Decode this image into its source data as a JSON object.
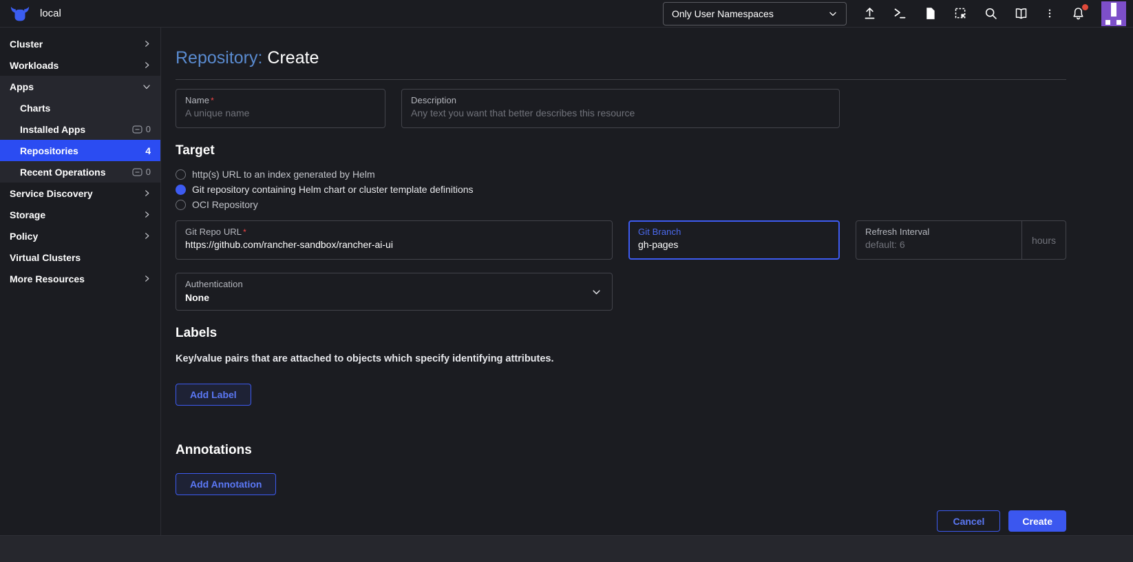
{
  "topbar": {
    "cluster_name": "local",
    "namespace_filter": "Only User Namespaces"
  },
  "sidebar": {
    "items": [
      {
        "label": "Cluster"
      },
      {
        "label": "Workloads"
      },
      {
        "label": "Apps"
      },
      {
        "label": "Charts"
      },
      {
        "label": "Installed Apps",
        "count": "0"
      },
      {
        "label": "Repositories",
        "count": "4"
      },
      {
        "label": "Recent Operations",
        "count": "0"
      },
      {
        "label": "Service Discovery"
      },
      {
        "label": "Storage"
      },
      {
        "label": "Policy"
      },
      {
        "label": "Virtual Clusters"
      },
      {
        "label": "More Resources"
      }
    ]
  },
  "page": {
    "title_type": "Repository:",
    "title_action": "Create",
    "fields": {
      "name": {
        "label": "Name",
        "required": "*",
        "placeholder": "A unique name",
        "value": ""
      },
      "description": {
        "label": "Description",
        "placeholder": "Any text you want that better describes this resource",
        "value": ""
      },
      "git_repo_url": {
        "label": "Git Repo URL",
        "required": "*",
        "value": "https://github.com/rancher-sandbox/rancher-ai-ui"
      },
      "git_branch": {
        "label": "Git Branch",
        "value": "gh-pages"
      },
      "refresh_interval": {
        "label": "Refresh Interval",
        "placeholder": "default: 6",
        "suffix": "hours"
      },
      "authentication": {
        "label": "Authentication",
        "value": "None"
      }
    },
    "target": {
      "heading": "Target",
      "options": [
        {
          "label": "http(s) URL to an index generated by Helm",
          "selected": false
        },
        {
          "label": "Git repository containing Helm chart or cluster template definitions",
          "selected": true
        },
        {
          "label": "OCI Repository",
          "selected": false
        }
      ]
    },
    "labels_section": {
      "heading": "Labels",
      "description": "Key/value pairs that are attached to objects which specify identifying attributes.",
      "add_button": "Add Label"
    },
    "annotations_section": {
      "heading": "Annotations",
      "add_button": "Add Annotation"
    },
    "footer": {
      "cancel": "Cancel",
      "create": "Create"
    }
  },
  "colors": {
    "accent_blue": "#3d5bf1",
    "sidebar_selected_blue": "#2b4cf2",
    "title_link_blue": "#5a8bd0",
    "avatar_purple": "#7d4fc9",
    "notification_dot_red": "#e0493a",
    "required_red": "#f64747",
    "background_dark": "#1b1c21"
  }
}
